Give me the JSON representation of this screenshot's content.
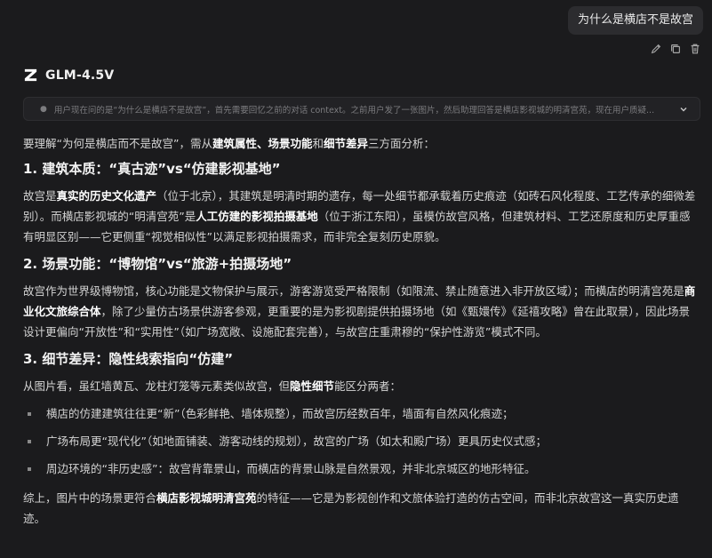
{
  "user_message": "为什么是横店不是故宫",
  "model": {
    "name": "GLM-4.5V"
  },
  "thinking": {
    "preview": "用户现在问的是“为什么是横店不是故宫”，首先需要回忆之前的对话 context。之前用户发了一张图片，然后助理回答是横店影视城的明清宫苑，现在用户质疑..."
  },
  "intro": {
    "a": "要理解“为何是横店而不是故宫”，需从",
    "b1": "建筑属性、场景功能",
    "c": "和",
    "b2": "细节差异",
    "d": "三方面分析："
  },
  "s1": {
    "title": "1. 建筑本质：“真古迹”vs“仿建影视基地”",
    "a": "故宫是",
    "b1": "真实的历史文化遗产",
    "c": "（位于北京），其建筑是明清时期的遗存，每一处细节都承载着历史痕迹（如砖石风化程度、工艺传承的细微差别）。而横店影视城的“明清宫苑”是",
    "b2": "人工仿建的影视拍摄基地",
    "d": "（位于浙江东阳），虽模仿故宫风格，但建筑材料、工艺还原度和历史厚重感有明显区别——它更侧重“视觉相似性”以满足影视拍摄需求，而非完全复刻历史原貌。"
  },
  "s2": {
    "title": "2. 场景功能：“博物馆”vs“旅游+拍摄场地”",
    "a": "故宫作为世界级博物馆，核心功能是文物保护与展示，游客游览受严格限制（如限流、禁止随意进入非开放区域）；而横店的明清宫苑是",
    "b1": "商业化文旅综合体",
    "c": "，除了少量仿古场景供游客参观，更重要的是为影视剧提供拍摄场地（如《甄嬛传》《延禧攻略》曾在此取景），因此场景设计更偏向“开放性”和“实用性”（如广场宽敞、设施配套完善），与故宫庄重肃穆的“保护性游览”模式不同。"
  },
  "s3": {
    "title": "3. 细节差异：隐性线索指向“仿建”",
    "a": "从图片看，虽红墙黄瓦、龙柱灯笼等元素类似故宫，但",
    "b1": "隐性细节",
    "c": "能区分两者：",
    "bullets": [
      "横店的仿建建筑往往更“新”（色彩鲜艳、墙体规整），而故宫历经数百年，墙面有自然风化痕迹；",
      "广场布局更“现代化”（如地面铺装、游客动线的规划），故宫的广场（如太和殿广场）更具历史仪式感；",
      "周边环境的“非历史感”：故宫背靠景山，而横店的背景山脉是自然景观，并非北京城区的地形特征。"
    ]
  },
  "conclusion": {
    "a": "综上，图片中的场景更符合",
    "b1": "横店影视城明清宫苑",
    "c": "的特征——它是为影视创作和文旅体验打造的仿古空间，而非北京故宫这一真实历史遗迹。"
  },
  "icons": {
    "edit": "pencil-icon",
    "copy": "copy-icon",
    "delete": "trash-icon",
    "logo": "z-logo-icon",
    "expand": "chevron-down-icon"
  }
}
